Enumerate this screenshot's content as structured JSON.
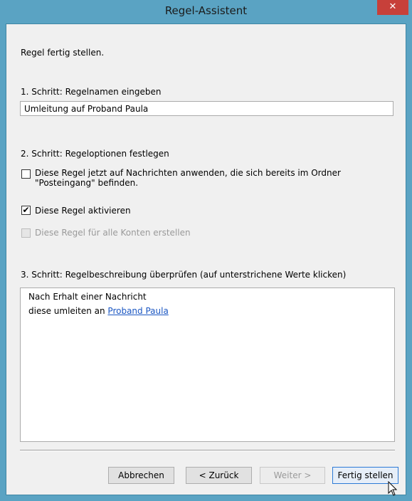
{
  "window": {
    "title": "Regel-Assistent",
    "close_glyph": "✕"
  },
  "heading": "Regel fertig stellen.",
  "step1": {
    "label": "1. Schritt: Regelnamen eingeben",
    "rule_name": "Umleitung auf Proband Paula"
  },
  "step2": {
    "label": "2. Schritt: Regeloptionen festlegen",
    "options": [
      {
        "line1": "Diese Regel jetzt auf Nachrichten anwenden, die sich bereits im Ordner",
        "line2": "\"Posteingang\" befinden.",
        "checked": false,
        "enabled": true
      },
      {
        "label": "Diese Regel aktivieren",
        "checked": true,
        "enabled": true,
        "check_glyph": "✔"
      },
      {
        "label": "Diese Regel für alle Konten erstellen",
        "checked": false,
        "enabled": false
      }
    ]
  },
  "step3": {
    "label": "3. Schritt: Regelbeschreibung überprüfen (auf unterstrichene Werte klicken)",
    "description": {
      "line1": "Nach Erhalt einer Nachricht",
      "line2_prefix": "diese umleiten an ",
      "line2_link": "Proband Paula"
    }
  },
  "buttons": {
    "cancel": "Abbrechen",
    "back": "< Zurück",
    "next": "Weiter >",
    "finish": "Fertig stellen"
  },
  "colors": {
    "title_bar": "#5aa3c3",
    "close": "#c7403a",
    "link": "#1a56c2",
    "focus_border": "#2c7ad6"
  }
}
